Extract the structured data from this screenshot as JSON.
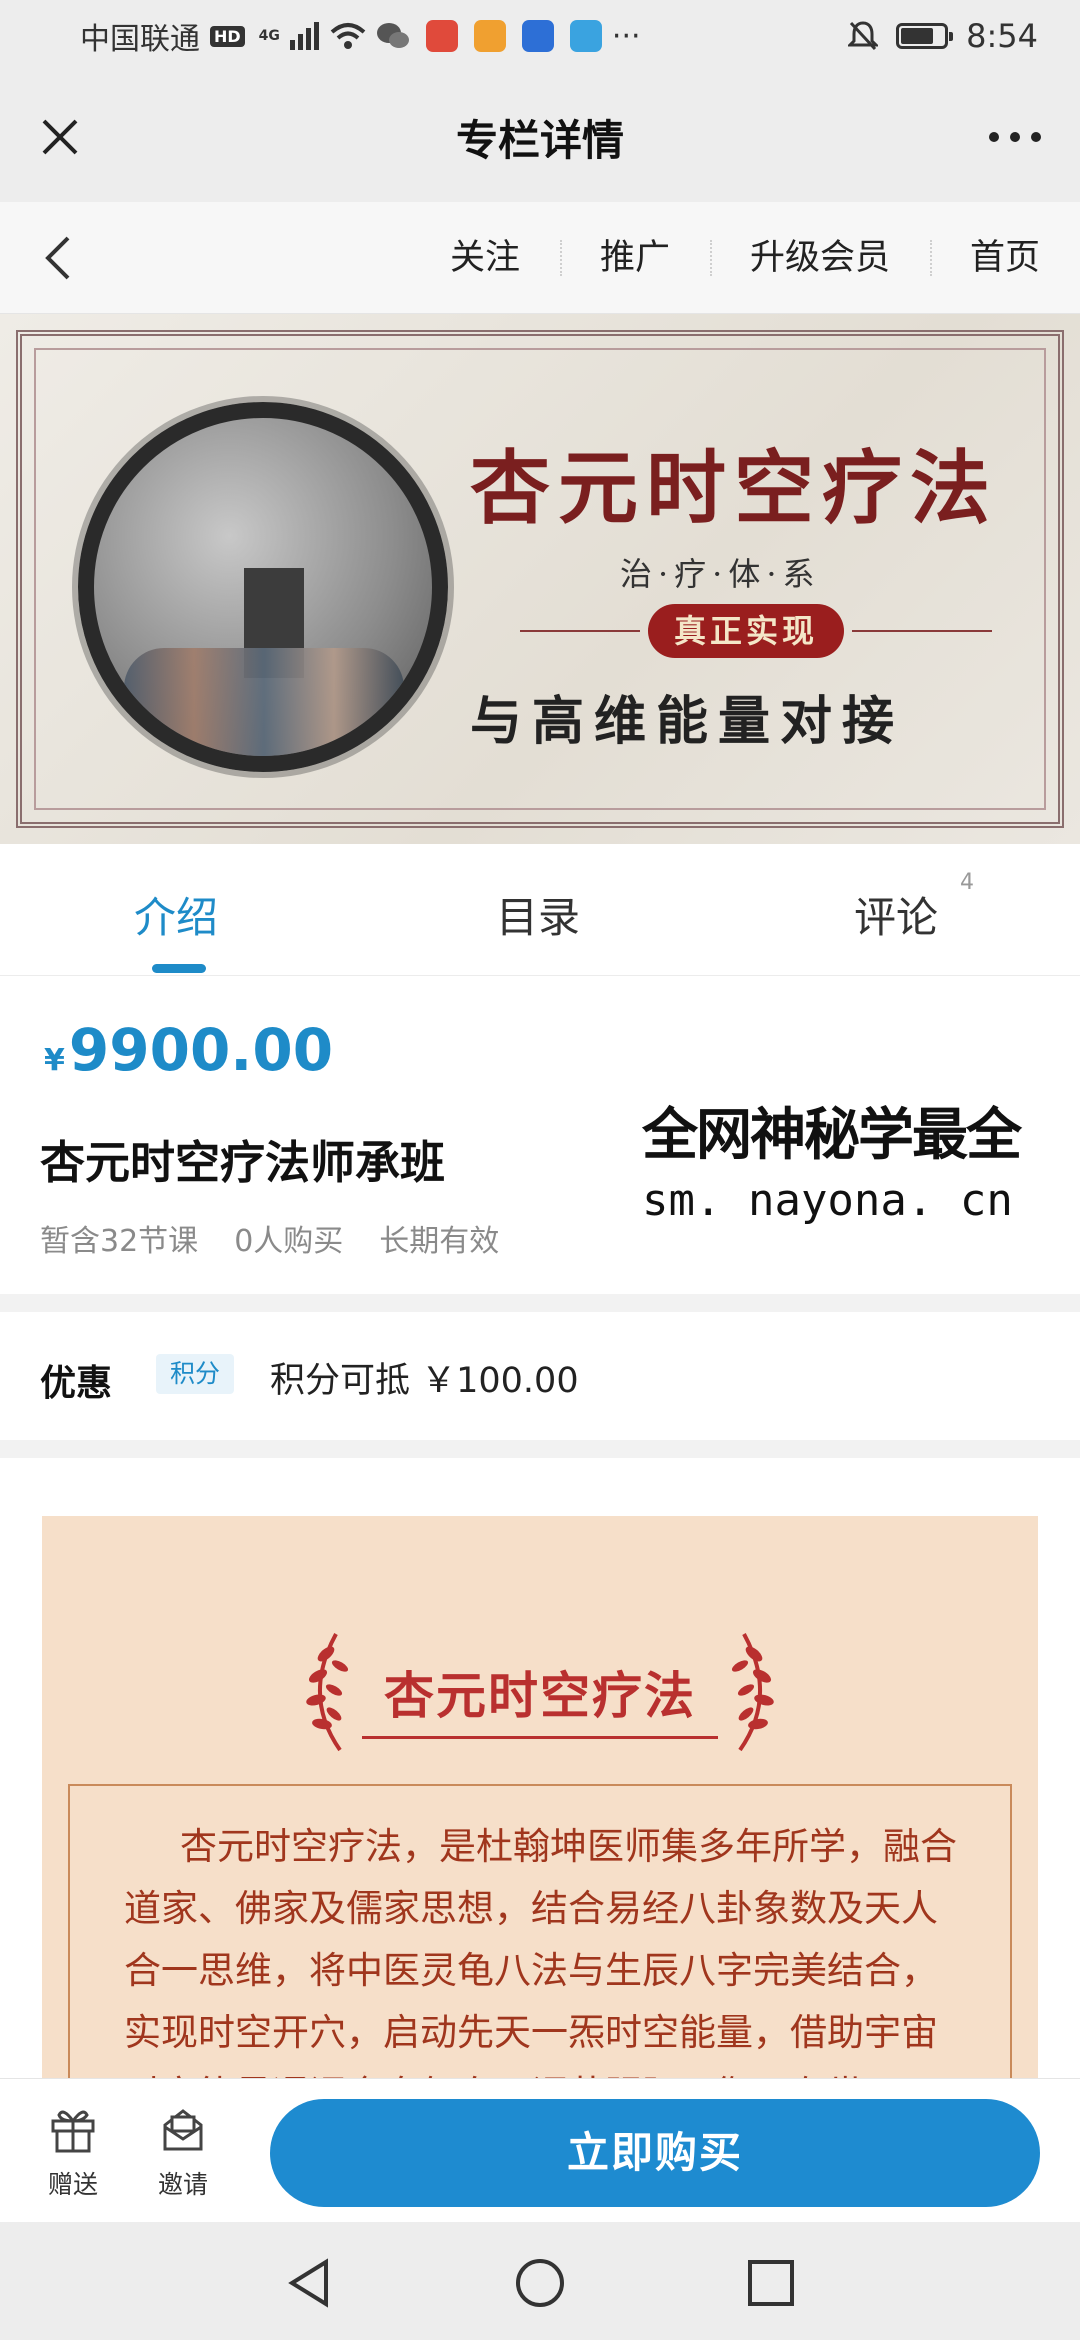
{
  "status_bar": {
    "carrier": "中国联通",
    "hd_badge": "HD",
    "network": "4G",
    "time": "8:54",
    "battery_level_percent": 75,
    "icons": [
      "signal-icon",
      "wifi-icon",
      "wechat-icon",
      "app-icon",
      "video-icon",
      "bulb-icon",
      "weather-icon",
      "more-dots-icon",
      "mute-icon",
      "battery-icon"
    ]
  },
  "title_bar": {
    "title": "专栏详情",
    "close_icon": "close-icon",
    "more_icon": "more-icon"
  },
  "nav_bar": {
    "back_icon": "back-icon",
    "links": [
      "关注",
      "推广",
      "升级会员",
      "首页"
    ]
  },
  "banner": {
    "title": "杏元时空疗法",
    "subtitle": "治·疗·体·系",
    "seal": "真正实现",
    "slogan": "与高维能量对接"
  },
  "tabs": {
    "items": [
      "介绍",
      "目录",
      "评论"
    ],
    "active": "介绍",
    "comment_count": "4"
  },
  "course": {
    "currency": "¥",
    "price": "9900.00",
    "title": "杏元时空疗法师承班",
    "lessons": "暂含32节课",
    "buyers": "0人购买",
    "validity": "长期有效"
  },
  "watermark": {
    "line1": "全网神秘学最全",
    "line2": "sm. nayona. cn"
  },
  "promotion": {
    "label": "优惠",
    "tag": "积分",
    "text": "积分可抵 ￥100.00"
  },
  "content": {
    "poster_title": "杏元时空疗法",
    "paragraph": "杏元时空疗法，是杜翰坤医师集多年所学，融合道家、佛家及儒家思想，结合易经八卦象数及天人合一思维，将中医灵龟八法与生辰八字完美结合，实现时空开穴，启动先天一炁时空能量，借助宇宙时空能量通调全身气血，调节阴阳平衡。在世"
  },
  "bottom_bar": {
    "gift_label": "赠送",
    "invite_label": "邀请",
    "buy_label": "立即购买"
  },
  "colors": {
    "accent": "#1e8bc8",
    "buy_button": "#1e8bd0",
    "poster_bg": "#f6dfc9",
    "poster_text": "#b9302f"
  }
}
